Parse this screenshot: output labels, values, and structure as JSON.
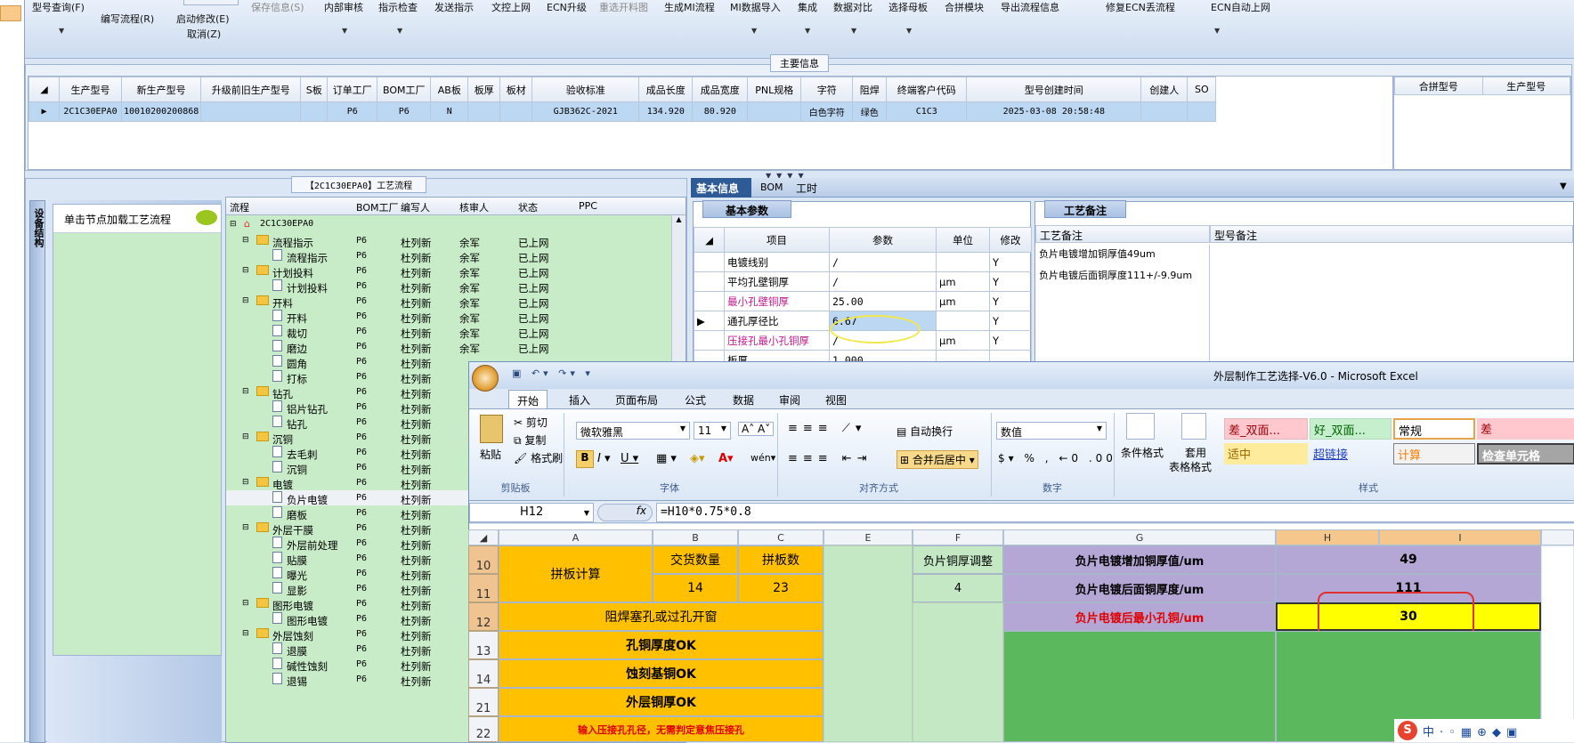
{
  "toolbar": {
    "items": [
      {
        "label": "型号查询(F)",
        "dis": false
      },
      {
        "label": "编写流程(R)",
        "dis": false
      },
      {
        "label": "启动修改(E)",
        "dis": false
      },
      {
        "label": "取消(Z)",
        "dis": false
      },
      {
        "label": "保存信息(S)",
        "dis": true
      },
      {
        "label": "内部审核",
        "dis": false
      },
      {
        "label": "指示检查",
        "dis": false
      },
      {
        "label": "发送指示",
        "dis": false
      },
      {
        "label": "文控上网",
        "dis": false
      },
      {
        "label": "ECN升级",
        "dis": false
      },
      {
        "label": "重选开料图",
        "dis": true
      },
      {
        "label": "生成MI流程",
        "dis": false
      },
      {
        "label": "MI数据导入",
        "dis": false
      },
      {
        "label": "集成",
        "dis": false
      },
      {
        "label": "数据对比",
        "dis": false
      },
      {
        "label": "选择母板",
        "dis": false
      },
      {
        "label": "合拼模块",
        "dis": false
      },
      {
        "label": "导出流程信息",
        "dis": false
      },
      {
        "label": "修复ECN丢流程",
        "dis": false
      },
      {
        "label": "ECN自动上网",
        "dis": false
      }
    ]
  },
  "main_info": {
    "title": "主要信息",
    "headers": [
      "生产型号",
      "新生产型号",
      "升级前旧生产型号",
      "S板",
      "订单工厂",
      "BOM工厂",
      "AB板",
      "板厚",
      "板材",
      "验收标准",
      "成品长度",
      "成品宽度",
      "PNL规格",
      "字符",
      "阻焊",
      "终端客户代码",
      "型号创建时间",
      "创建人",
      "SO"
    ],
    "row": [
      "2C1C30EPA0",
      "10010200200868",
      "",
      "",
      "P6",
      "P6",
      "N",
      "",
      "",
      "GJB362C-2021",
      "134.920",
      "80.920",
      "",
      "白色字符",
      "绿色",
      "C1C3",
      "2025-03-08 20:58:48",
      "",
      ""
    ],
    "merge_headers": [
      "合拼型号",
      "生产型号"
    ]
  },
  "process": {
    "title": "【2C1C30EPA0】工艺流程",
    "side_tab": "设备结构",
    "hint": "单击节点加载工艺流程",
    "headers": [
      "流程",
      "BOM工厂",
      "编写人",
      "核审人",
      "状态",
      "PPC"
    ],
    "root": "2C1C30EPA0",
    "rows": [
      {
        "name": "流程指示",
        "folder": true,
        "bom": "P6",
        "w": "杜列新",
        "r": "余军",
        "s": "已上网"
      },
      {
        "name": "流程指示",
        "folder": false,
        "bom": "P6",
        "w": "杜列新",
        "r": "余军",
        "s": "已上网"
      },
      {
        "name": "计划投料",
        "folder": true,
        "bom": "P6",
        "w": "杜列新",
        "r": "余军",
        "s": "已上网"
      },
      {
        "name": "计划投料",
        "folder": false,
        "bom": "P6",
        "w": "杜列新",
        "r": "余军",
        "s": "已上网"
      },
      {
        "name": "开料",
        "folder": true,
        "bom": "P6",
        "w": "杜列新",
        "r": "余军",
        "s": "已上网"
      },
      {
        "name": "开料",
        "folder": false,
        "bom": "P6",
        "w": "杜列新",
        "r": "余军",
        "s": "已上网"
      },
      {
        "name": "裁切",
        "folder": false,
        "bom": "P6",
        "w": "杜列新",
        "r": "余军",
        "s": "已上网"
      },
      {
        "name": "磨边",
        "folder": false,
        "bom": "P6",
        "w": "杜列新",
        "r": "余军",
        "s": "已上网"
      },
      {
        "name": "圆角",
        "folder": false,
        "bom": "P6",
        "w": "杜列新",
        "r": "",
        "s": ""
      },
      {
        "name": "打标",
        "folder": false,
        "bom": "P6",
        "w": "杜列新",
        "r": "",
        "s": ""
      },
      {
        "name": "钻孔",
        "folder": true,
        "bom": "P6",
        "w": "杜列新",
        "r": "",
        "s": ""
      },
      {
        "name": "铝片钻孔",
        "folder": false,
        "bom": "P6",
        "w": "杜列新",
        "r": "",
        "s": ""
      },
      {
        "name": "钻孔",
        "folder": false,
        "bom": "P6",
        "w": "杜列新",
        "r": "",
        "s": ""
      },
      {
        "name": "沉铜",
        "folder": true,
        "bom": "P6",
        "w": "杜列新",
        "r": "",
        "s": ""
      },
      {
        "name": "去毛刺",
        "folder": false,
        "bom": "P6",
        "w": "杜列新",
        "r": "",
        "s": ""
      },
      {
        "name": "沉铜",
        "folder": false,
        "bom": "P6",
        "w": "杜列新",
        "r": "",
        "s": ""
      },
      {
        "name": "电镀",
        "folder": true,
        "bom": "P6",
        "w": "杜列新",
        "r": "",
        "s": ""
      },
      {
        "name": "负片电镀",
        "folder": false,
        "bom": "P6",
        "w": "杜列新",
        "r": "",
        "s": ""
      },
      {
        "name": "磨板",
        "folder": false,
        "bom": "P6",
        "w": "杜列新",
        "r": "",
        "s": ""
      },
      {
        "name": "外层干膜",
        "folder": true,
        "bom": "P6",
        "w": "杜列新",
        "r": "",
        "s": ""
      },
      {
        "name": "外层前处理",
        "folder": false,
        "bom": "P6",
        "w": "杜列新",
        "r": "",
        "s": ""
      },
      {
        "name": "贴膜",
        "folder": false,
        "bom": "P6",
        "w": "杜列新",
        "r": "",
        "s": ""
      },
      {
        "name": "曝光",
        "folder": false,
        "bom": "P6",
        "w": "杜列新",
        "r": "",
        "s": ""
      },
      {
        "name": "显影",
        "folder": false,
        "bom": "P6",
        "w": "杜列新",
        "r": "",
        "s": ""
      },
      {
        "name": "图形电镀",
        "folder": true,
        "bom": "P6",
        "w": "杜列新",
        "r": "",
        "s": ""
      },
      {
        "name": "图形电镀",
        "folder": false,
        "bom": "P6",
        "w": "杜列新",
        "r": "",
        "s": ""
      },
      {
        "name": "外层蚀刻",
        "folder": true,
        "bom": "P6",
        "w": "杜列新",
        "r": "",
        "s": ""
      },
      {
        "name": "退膜",
        "folder": false,
        "bom": "P6",
        "w": "杜列新",
        "r": "",
        "s": ""
      },
      {
        "name": "碱性蚀刻",
        "folder": false,
        "bom": "P6",
        "w": "杜列新",
        "r": "",
        "s": ""
      },
      {
        "name": "退锡",
        "folder": false,
        "bom": "P6",
        "w": "杜列新",
        "r": "",
        "s": ""
      }
    ]
  },
  "detail": {
    "tabs": [
      "基本信息",
      "BOM",
      "工时"
    ],
    "basic_title": "基本参数",
    "headers": [
      "项目",
      "参数",
      "单位",
      "修改"
    ],
    "rows": [
      {
        "item": "电镀线别",
        "param": "/",
        "unit": "",
        "mod": "Y",
        "pink": false
      },
      {
        "item": "平均孔壁铜厚",
        "param": "/",
        "unit": "μm",
        "mod": "Y",
        "pink": false
      },
      {
        "item": "最小孔壁铜厚",
        "param": "25.00",
        "unit": "μm",
        "mod": "Y",
        "pink": true
      },
      {
        "item": "通孔厚径比",
        "param": "6.67",
        "unit": "",
        "mod": "Y",
        "pink": false
      },
      {
        "item": "压接孔最小孔铜厚",
        "param": "/",
        "unit": "μm",
        "mod": "Y",
        "pink": true
      },
      {
        "item": "板厚",
        "param": "1.000",
        "unit": "",
        "mod": "",
        "pink": false
      }
    ],
    "notes_title": "工艺备注",
    "notes_header": "工艺备注",
    "model_note_header": "型号备注",
    "notes": [
      "负片电镀增加铜厚值49um",
      "负片电镀后面铜厚度111+/-9.9um"
    ]
  },
  "excel": {
    "title": "外层制作工艺选择-V6.0 - Microsoft Excel",
    "tabs": [
      "开始",
      "插入",
      "页面布局",
      "公式",
      "数据",
      "审阅",
      "视图"
    ],
    "clipboard": {
      "paste": "粘贴",
      "cut": "剪切",
      "copy": "复制",
      "painter": "格式刷",
      "group": "剪贴板"
    },
    "font": {
      "name": "微软雅黑",
      "size": "11",
      "group": "字体"
    },
    "align": {
      "wrap": "自动换行",
      "merge": "合并后居中",
      "group": "对齐方式"
    },
    "number": {
      "format": "数值",
      "group": "数字"
    },
    "styles": {
      "cond": "条件格式",
      "table": "套用",
      "table2": "表格格式",
      "group": "样式",
      "cells": [
        "差_双面...",
        "好_双面...",
        "常规",
        "差",
        "适中",
        "超链接",
        "计算",
        "检查单元格"
      ]
    },
    "namebox": "H12",
    "fx": "fx",
    "formula": "=H10*0.75*0.8",
    "cols": [
      "A",
      "B",
      "C",
      "E",
      "F",
      "G",
      "H",
      "I"
    ],
    "rows_num": [
      "10",
      "11",
      "12",
      "13",
      "14",
      "21",
      "22"
    ],
    "cells": {
      "a10": "拼板计算",
      "b10": "交货数量",
      "c10": "拼板数",
      "b11": "14",
      "c11": "23",
      "f10": "负片铜厚调整",
      "f11": "4",
      "g10": "负片电镀增加铜厚值/um",
      "g11": "负片电镀后面铜厚度/um",
      "g12": "负片电镀后最小孔铜/um",
      "h10": "49",
      "h11": "111",
      "h12": "30",
      "a12": "阻焊塞孔或过孔开窗",
      "a13": "孔铜厚度OK",
      "a14": "蚀刻基铜OK",
      "a21": "外层铜厚OK",
      "a22": "输入压接孔孔径，无需判定意焦压接孔"
    }
  }
}
